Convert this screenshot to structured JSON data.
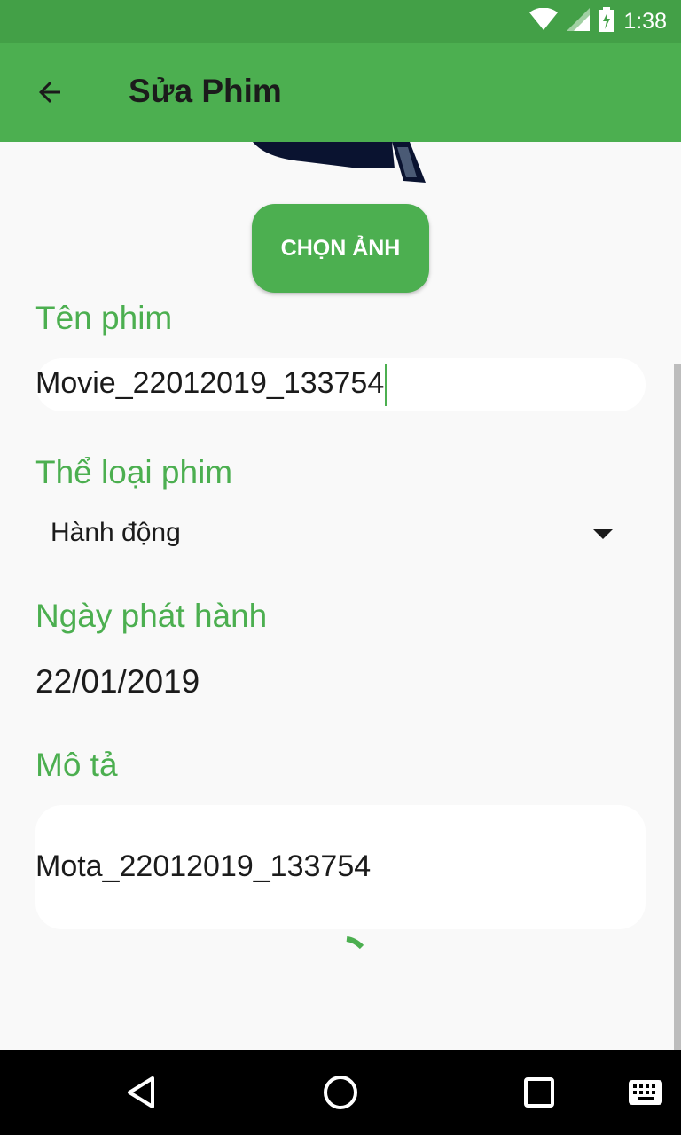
{
  "status_bar": {
    "time": "1:38",
    "icons": [
      "wifi-icon",
      "cell-signal-icon",
      "battery-charging-icon"
    ]
  },
  "app_bar": {
    "title": "Sửa Phim",
    "back_icon": "arrow-back-icon"
  },
  "form": {
    "pick_image_label": "CHỌN ẢNH",
    "name_label": "Tên phim",
    "name_value": "Movie_22012019_133754",
    "genre_label": "Thể loại phim",
    "genre_selected": "Hành động",
    "release_label": "Ngày phát hành",
    "release_value": "22/01/2019",
    "description_label": "Mô tả",
    "description_value": "Mota_22012019_133754"
  },
  "nav_bar": {
    "icons": [
      "back-triangle-icon",
      "home-circle-icon",
      "recents-square-icon",
      "keyboard-icon"
    ]
  },
  "colors": {
    "status_bar": "#43a047",
    "app_bar": "#4caf50",
    "accent": "#4caf50",
    "background": "#f9f9f9"
  }
}
